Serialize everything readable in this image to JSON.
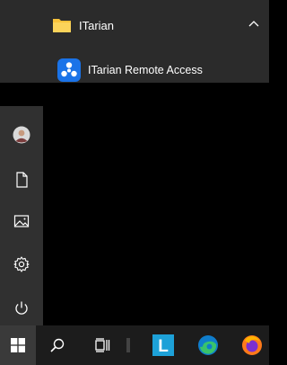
{
  "start_menu": {
    "folder": {
      "label": "ITarian",
      "icon": "folder-icon",
      "expanded": true
    },
    "apps": [
      {
        "label": "ITarian Remote Access",
        "icon": "itarian-remote-access-icon"
      }
    ]
  },
  "side_rail": {
    "items": [
      {
        "name": "user-account",
        "icon": "avatar-icon"
      },
      {
        "name": "documents",
        "icon": "document-icon"
      },
      {
        "name": "pictures",
        "icon": "image-icon"
      },
      {
        "name": "settings",
        "icon": "gear-icon"
      },
      {
        "name": "power",
        "icon": "power-icon"
      }
    ]
  },
  "taskbar": {
    "items": [
      {
        "name": "start",
        "icon": "windows-logo-icon"
      },
      {
        "name": "search",
        "icon": "search-icon"
      },
      {
        "name": "task-view",
        "icon": "task-view-icon"
      },
      {
        "name": "launcher",
        "icon": "launcher-l-icon",
        "glyph": "L"
      },
      {
        "name": "edge",
        "icon": "edge-icon"
      },
      {
        "name": "firefox",
        "icon": "firefox-icon"
      }
    ]
  },
  "colors": {
    "accent_blue": "#1a73e8",
    "folder_yellow": "#f8c23b",
    "launcher_blue": "#1da1d8"
  }
}
